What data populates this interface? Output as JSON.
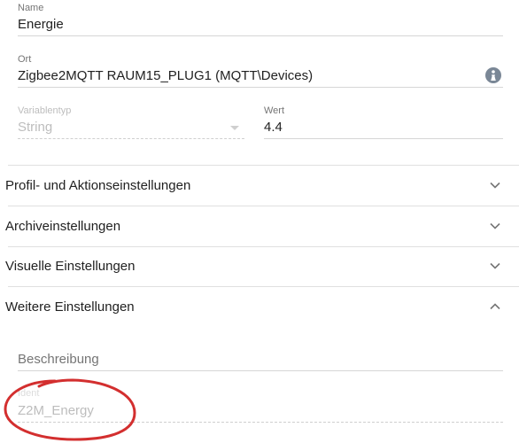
{
  "name_field": {
    "label": "Name",
    "value": "Energie"
  },
  "location_field": {
    "label": "Ort",
    "value": "Zigbee2MQTT RAUM15_PLUG1 (MQTT\\Devices)",
    "icon": "info-icon"
  },
  "variable_type_field": {
    "label": "Variablentyp",
    "value": "String",
    "disabled": true
  },
  "value_field": {
    "label": "Wert",
    "value": "4.4"
  },
  "sections": [
    {
      "label": "Profil- und Aktionseinstellungen",
      "expanded": false
    },
    {
      "label": "Archiveinstellungen",
      "expanded": false
    },
    {
      "label": "Visuelle Einstellungen",
      "expanded": false
    },
    {
      "label": "Weitere Einstellungen",
      "expanded": true
    }
  ],
  "description_field": {
    "placeholder": "Beschreibung"
  },
  "ident_field": {
    "label": "Ident",
    "value": "Z2M_Energy",
    "disabled": true
  },
  "annotation": {
    "shape": "hand-drawn circle",
    "color": "#d32f2f"
  }
}
